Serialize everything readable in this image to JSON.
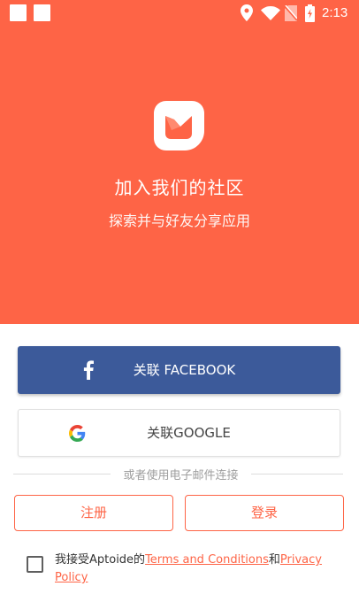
{
  "status_bar": {
    "time": "2:13",
    "icons": [
      "notification-square-icon",
      "notification-square-icon",
      "location-icon",
      "wifi-icon",
      "no-sim-icon",
      "battery-charging-icon"
    ]
  },
  "hero": {
    "logo": "aptoide-logo",
    "title": "加入我们的社区",
    "subtitle": "探索并与好友分享应用",
    "background_color": "#fe6446"
  },
  "social": {
    "facebook_label": "关联 FACEBOOK",
    "facebook_icon": "facebook-icon",
    "facebook_color": "#3c5a9a",
    "google_label": "关联GOOGLE",
    "google_icon": "google-icon"
  },
  "divider": {
    "text": "或者使用电子邮件连接"
  },
  "actions": {
    "register_label": "注册",
    "login_label": "登录",
    "accent_color": "#fe6446"
  },
  "terms": {
    "prefix": "我接受Aptoide的",
    "terms_link": "Terms and Conditions",
    "middle": "和",
    "privacy_link": "Privacy Policy",
    "checked": false
  }
}
